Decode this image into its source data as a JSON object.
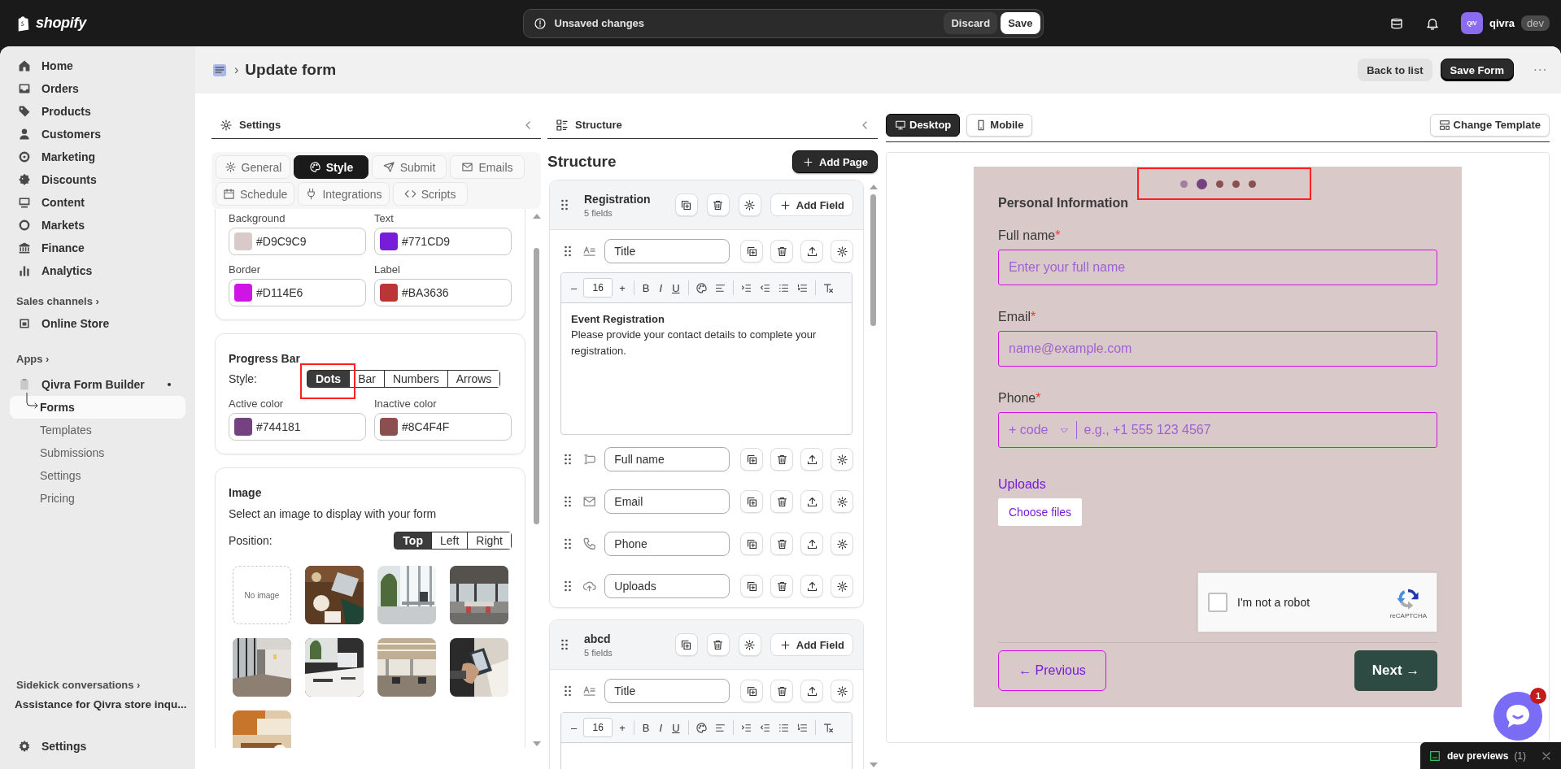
{
  "topbar": {
    "brand": "shopify",
    "notice": "Unsaved changes",
    "discard": "Discard",
    "save": "Save",
    "avatar": "QIV",
    "store": "qivra",
    "env": "dev"
  },
  "sidebar": {
    "items": [
      {
        "label": "Home"
      },
      {
        "label": "Orders"
      },
      {
        "label": "Products"
      },
      {
        "label": "Customers"
      },
      {
        "label": "Marketing"
      },
      {
        "label": "Discounts"
      },
      {
        "label": "Content"
      },
      {
        "label": "Markets"
      },
      {
        "label": "Finance"
      },
      {
        "label": "Analytics"
      }
    ],
    "sales_channels": "Sales channels",
    "chevron": "›",
    "channels": [
      {
        "label": "Online Store"
      }
    ],
    "apps": "Apps",
    "apps_chevron": "›",
    "app": {
      "label": "Qivra Form Builder",
      "children": [
        {
          "label": "Forms",
          "selected": true
        },
        {
          "label": "Templates",
          "selected": false
        },
        {
          "label": "Submissions",
          "selected": false
        },
        {
          "label": "Settings",
          "selected": false
        },
        {
          "label": "Pricing",
          "selected": false
        }
      ]
    },
    "sidekick": "Sidekick conversations",
    "sidekick_chevron": "›",
    "conversations": [
      "Assistance for Qivra store inqu..."
    ],
    "settings": "Settings"
  },
  "page": {
    "separator": "›",
    "title": "Update form",
    "actions": [
      {
        "label": "Back to list",
        "kind": "secondary"
      },
      {
        "label": "Save Form",
        "kind": "primary"
      }
    ]
  },
  "settings_panel": {
    "title": "Settings",
    "tabs": [
      {
        "label": "General",
        "selected": false
      },
      {
        "label": "Style",
        "selected": true
      },
      {
        "label": "Submit",
        "selected": false
      },
      {
        "label": "Emails",
        "selected": false
      },
      {
        "label": "Schedule",
        "selected": false
      },
      {
        "label": "Integrations",
        "selected": false
      },
      {
        "label": "Scripts",
        "selected": false
      }
    ],
    "colors": [
      {
        "label": "Background",
        "value": "#D9C9C9",
        "color": "#d9c9c9"
      },
      {
        "label": "Text",
        "value": "#771CD9",
        "color": "#771cd9"
      },
      {
        "label": "Border",
        "value": "#D114E6",
        "color": "#d114e6"
      },
      {
        "label": "Label",
        "value": "#BA3636",
        "color": "#ba3636"
      }
    ],
    "progress_bar": {
      "title": "Progress Bar",
      "style_label": "Style:",
      "styles": [
        {
          "label": "Dots",
          "selected": true
        },
        {
          "label": "Bar",
          "selected": false
        },
        {
          "label": "Numbers",
          "selected": false
        },
        {
          "label": "Arrows",
          "selected": false
        }
      ],
      "colors": [
        {
          "label": "Active color",
          "value": "#744181",
          "color": "#744181"
        },
        {
          "label": "Inactive color",
          "value": "#8C4F4F",
          "color": "#8c4f4f"
        }
      ]
    },
    "image": {
      "title": "Image",
      "description": "Select an image to display with your form",
      "position_label": "Position:",
      "positions": [
        {
          "label": "Top",
          "selected": true
        },
        {
          "label": "Left",
          "selected": false
        },
        {
          "label": "Right",
          "selected": false
        }
      ],
      "thumbnails": [
        {
          "kind": "empty",
          "label": "No image"
        },
        {
          "kind": "picture"
        },
        {
          "kind": "picture"
        },
        {
          "kind": "picture"
        },
        {
          "kind": "picture"
        },
        {
          "kind": "picture"
        },
        {
          "kind": "picture"
        },
        {
          "kind": "picture"
        },
        {
          "kind": "picture"
        }
      ]
    }
  },
  "structure_panel": {
    "title": "Structure",
    "heading": "Structure",
    "add_page": "Add Page",
    "pages": [
      {
        "name": "Registration",
        "count": "5 fields",
        "add_field": "Add Field",
        "fields": [
          {
            "kind": "title",
            "label": "Title",
            "editor": {
              "minus": "–",
              "size": "16",
              "plus": "+",
              "bold": "B",
              "italic": "I",
              "underline": "U",
              "heading": "Event Registration",
              "body": "Please provide your contact details to complete your registration."
            }
          },
          {
            "kind": "text",
            "label": "Full name"
          },
          {
            "kind": "email",
            "label": "Email"
          },
          {
            "kind": "phone",
            "label": "Phone"
          },
          {
            "kind": "upload",
            "label": "Uploads"
          }
        ]
      },
      {
        "name": "abcd",
        "count": "5 fields",
        "add_field": "Add Field",
        "fields": [
          {
            "kind": "title",
            "label": "Title",
            "editor": {
              "minus": "–",
              "size": "16",
              "plus": "+",
              "bold": "B",
              "italic": "I",
              "underline": "U"
            }
          }
        ]
      }
    ]
  },
  "preview": {
    "tabs": [
      {
        "label": "Desktop",
        "selected": true
      },
      {
        "label": "Mobile",
        "selected": false
      }
    ],
    "change_template": "Change Template",
    "progress": [
      {
        "kind": "visited"
      },
      {
        "kind": "current"
      },
      {
        "kind": "upcoming"
      },
      {
        "kind": "upcoming"
      },
      {
        "kind": "upcoming"
      }
    ],
    "section": "Personal Information",
    "required_mark": "*",
    "fields": [
      {
        "kind": "text",
        "label": "Full name",
        "required": true,
        "placeholder": "Enter your full name"
      },
      {
        "kind": "email",
        "label": "Email",
        "required": true,
        "placeholder": "name@example.com"
      },
      {
        "kind": "phone",
        "label": "Phone",
        "required": true,
        "code": "+ code",
        "placeholder": "e.g., +1 555 123 4567"
      },
      {
        "kind": "upload",
        "label": "Uploads",
        "required": false,
        "button": "Choose files"
      }
    ],
    "captcha": {
      "label": "I'm not a robot",
      "brand": "reCAPTCHA",
      "checked": false
    },
    "previous": "← Previous",
    "next": "Next →"
  },
  "chat": {
    "badge": "1"
  },
  "dev_previews": {
    "label": "dev previews",
    "count": "(1)"
  }
}
